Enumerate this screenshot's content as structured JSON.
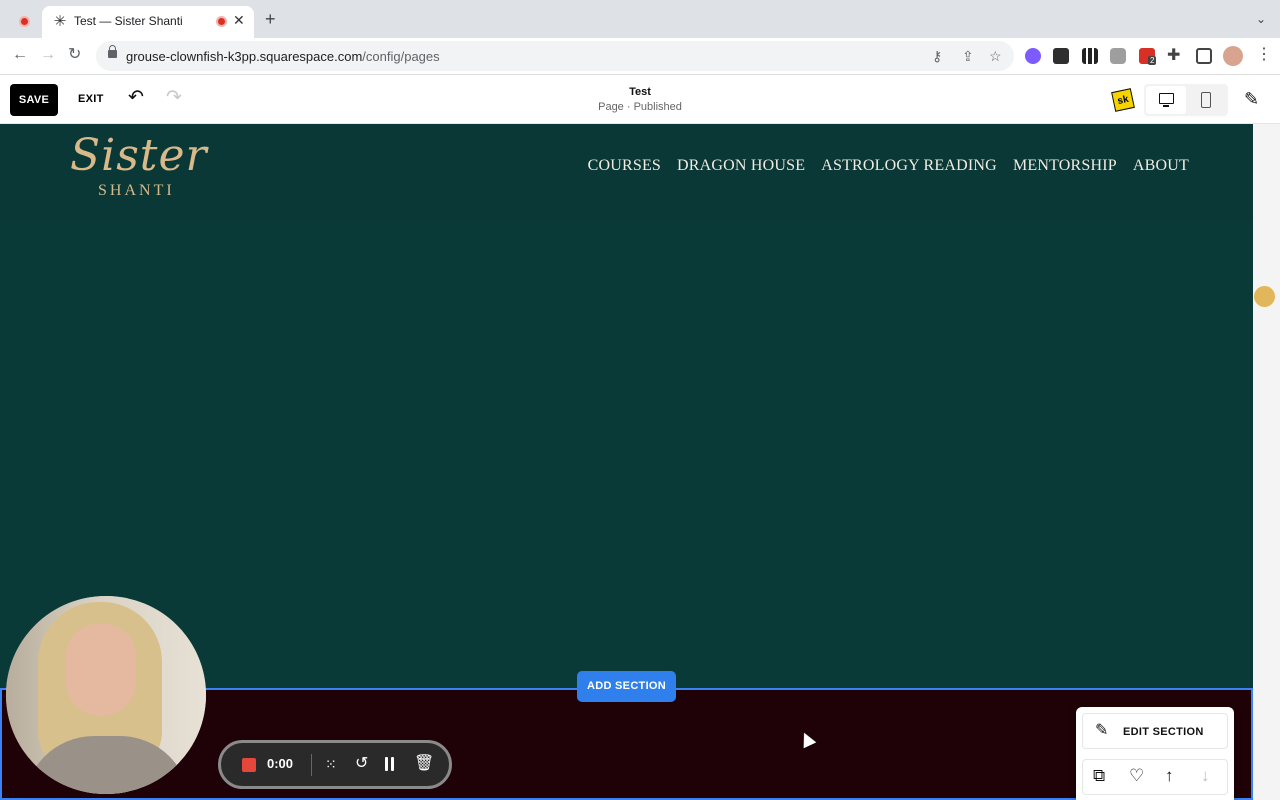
{
  "browser": {
    "tab_title": "Test — Sister Shanti",
    "tab_favicon": "✳",
    "new_tab_label": "+",
    "url_host": "grouse-clownfish-k3pp.squarespace.com",
    "url_path": "/config/pages",
    "extension_badge": "2"
  },
  "editor": {
    "save_label": "SAVE",
    "exit_label": "EXIT",
    "page_title": "Test",
    "page_status": "Page · Published",
    "sk_badge": "sk"
  },
  "site": {
    "logo_script": "Sister",
    "logo_sub": "SHANTI",
    "nav": [
      "COURSES",
      "DRAGON HOUSE",
      "ASTROLOGY READING",
      "MENTORSHIP",
      "ABOUT"
    ],
    "add_section_label": "ADD SECTION",
    "edit_section_label": "EDIT SECTION",
    "colors": {
      "header_bg": "#0a3836",
      "section_bg": "#0a3a38",
      "dark_section_bg": "#1e0207",
      "logo_gold": "#d7b98a",
      "selection_blue": "#3b82f6"
    }
  },
  "recorder": {
    "timer": "0:00"
  }
}
